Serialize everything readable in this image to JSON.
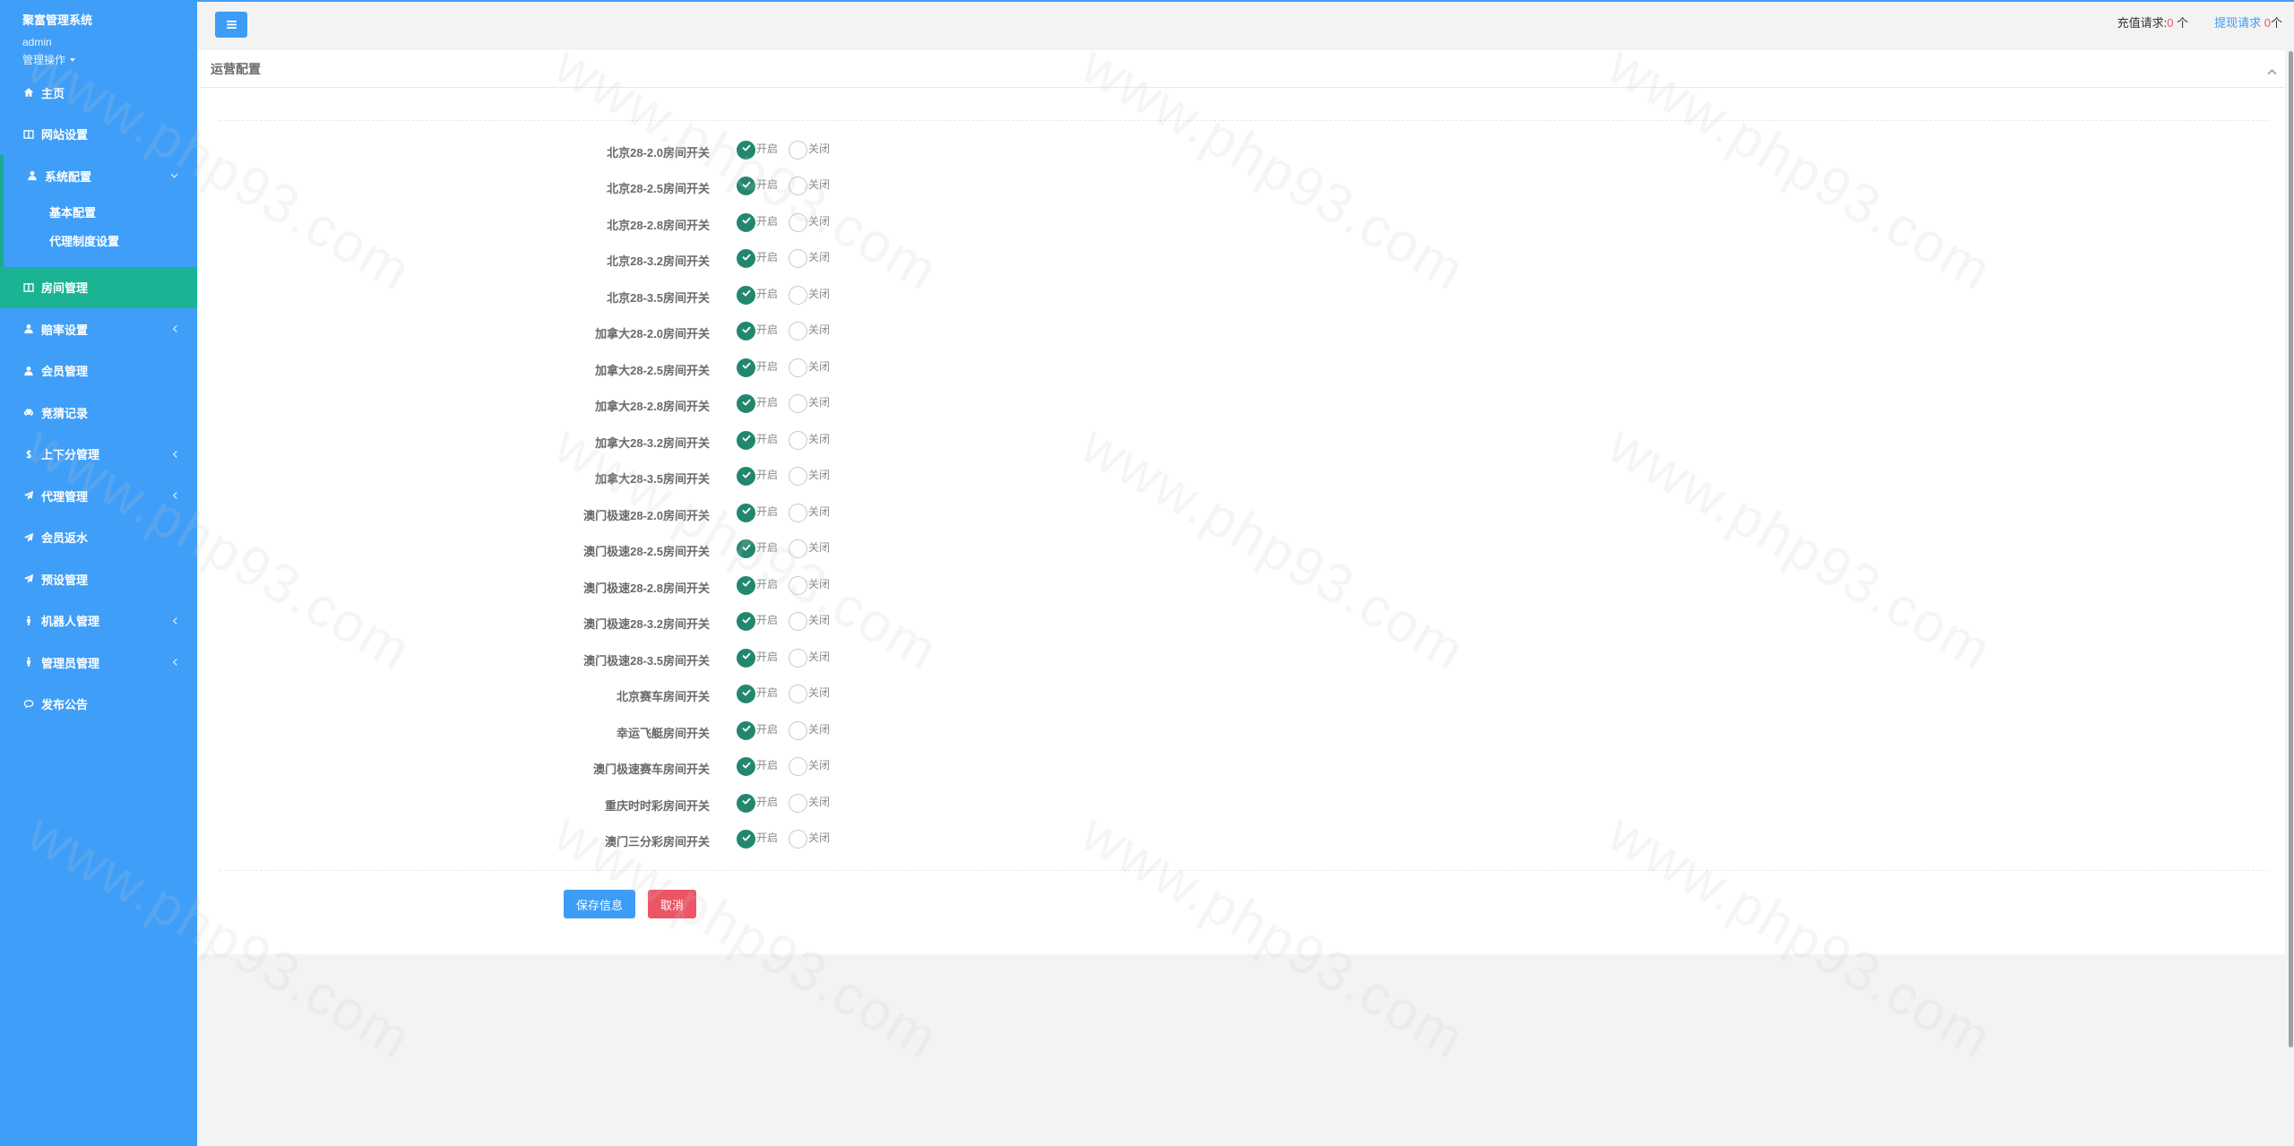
{
  "app": {
    "title": "聚富管理系统",
    "user": "admin",
    "user_menu": "管理操作"
  },
  "sidebar": {
    "items": [
      {
        "label": "主页",
        "icon": "home-icon"
      },
      {
        "label": "网站设置",
        "icon": "columns-icon"
      },
      {
        "label": "系统配置",
        "icon": "user-icon",
        "expanded": true,
        "children": [
          {
            "label": "基本配置"
          },
          {
            "label": "代理制度设置"
          }
        ]
      },
      {
        "label": "房间管理",
        "icon": "columns-icon",
        "active": true
      },
      {
        "label": "赔率设置",
        "icon": "user-icon",
        "has_submenu": true
      },
      {
        "label": "会员管理",
        "icon": "user-icon"
      },
      {
        "label": "竞猜记录",
        "icon": "car-icon"
      },
      {
        "label": "上下分管理",
        "icon": "dollar-icon",
        "has_submenu": true
      },
      {
        "label": "代理管理",
        "icon": "paper-plane-icon",
        "has_submenu": true
      },
      {
        "label": "会员返水",
        "icon": "paper-plane-icon"
      },
      {
        "label": "预设管理",
        "icon": "paper-plane-icon"
      },
      {
        "label": "机器人管理",
        "icon": "male-icon",
        "has_submenu": true
      },
      {
        "label": "管理员管理",
        "icon": "male-icon",
        "has_submenu": true
      },
      {
        "label": "发布公告",
        "icon": "comments-icon"
      }
    ]
  },
  "topbar": {
    "menu_icon": "bars-icon",
    "recharge": {
      "label": "充值请求:",
      "count": "0",
      "unit": " 个"
    },
    "withdraw": {
      "label": "提现请求",
      "count": "0",
      "unit": "个"
    }
  },
  "panel": {
    "title": "运营配置",
    "collapse_icon": "chevron-up-icon",
    "options": [
      "开启",
      "关闭"
    ],
    "rows": [
      {
        "label": "北京28-2.0房间开关",
        "on": true
      },
      {
        "label": "北京28-2.5房间开关",
        "on": true
      },
      {
        "label": "北京28-2.8房间开关",
        "on": true
      },
      {
        "label": "北京28-3.2房间开关",
        "on": true
      },
      {
        "label": "北京28-3.5房间开关",
        "on": true
      },
      {
        "label": "加拿大28-2.0房间开关",
        "on": true
      },
      {
        "label": "加拿大28-2.5房间开关",
        "on": true
      },
      {
        "label": "加拿大28-2.8房间开关",
        "on": true
      },
      {
        "label": "加拿大28-3.2房间开关",
        "on": true
      },
      {
        "label": "加拿大28-3.5房间开关",
        "on": true
      },
      {
        "label": "澳门极速28-2.0房间开关",
        "on": true
      },
      {
        "label": "澳门极速28-2.5房间开关",
        "on": true
      },
      {
        "label": "澳门极速28-2.8房间开关",
        "on": true
      },
      {
        "label": "澳门极速28-3.2房间开关",
        "on": true
      },
      {
        "label": "澳门极速28-3.5房间开关",
        "on": true
      },
      {
        "label": "北京赛车房间开关",
        "on": true
      },
      {
        "label": "幸运飞艇房间开关",
        "on": true
      },
      {
        "label": "澳门极速赛车房间开关",
        "on": true
      },
      {
        "label": "重庆时时彩房间开关",
        "on": true
      },
      {
        "label": "澳门三分彩房间开关",
        "on": true
      }
    ]
  },
  "actions": {
    "save": "保存信息",
    "cancel": "取消"
  },
  "colors": {
    "sidebar": "#3f9ef8",
    "active": "#1ab394",
    "indicator": "#19aa8d",
    "primary": "#3d9cf5",
    "danger": "#ed5565",
    "radio": "#23876f",
    "bg": "#f3f3f4"
  },
  "watermark": "www.php93.com"
}
